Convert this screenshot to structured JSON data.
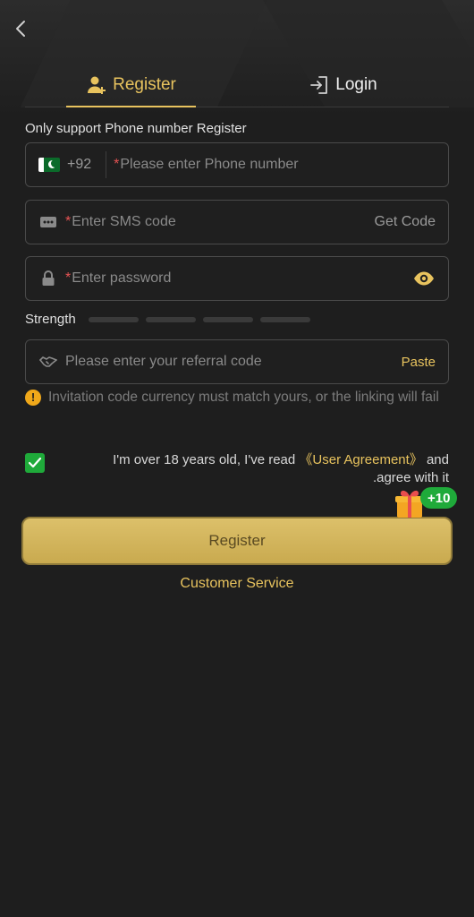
{
  "tabs": {
    "register_label": "Register",
    "login_label": "Login"
  },
  "section_label": "Only support Phone number Register",
  "phone": {
    "country_code": "+92",
    "required_mark": "*",
    "placeholder": "Please enter Phone number"
  },
  "sms": {
    "required_mark": "*",
    "placeholder": "Enter SMS code",
    "get_code_label": "Get Code"
  },
  "password": {
    "required_mark": "*",
    "placeholder": "Enter password"
  },
  "strength_label": "Strength",
  "referral": {
    "placeholder": "Please enter your referral code",
    "paste_label": "Paste"
  },
  "warning": {
    "icon": "!",
    "text": "Invitation code currency must match yours, or the linking will fail"
  },
  "agreement": {
    "checked": true,
    "text_before": "I'm over 18 years old, I've read ",
    "link": "《User Agreement》",
    "text_after": " and .agree with it"
  },
  "bonus_badge": "+10",
  "register_button_label": "Register",
  "customer_service_label": "Customer Service",
  "colors": {
    "accent": "#e8c35e",
    "background": "#1e1e1e",
    "check": "#1faa3a",
    "required": "#e55353"
  },
  "icons": [
    "back-arrow-icon",
    "add-user-icon",
    "login-door-icon",
    "pakistan-flag-icon",
    "sms-dots-icon",
    "lock-icon",
    "eye-icon",
    "handshake-icon",
    "warning-icon",
    "checkmark-icon",
    "gift-icon"
  ]
}
